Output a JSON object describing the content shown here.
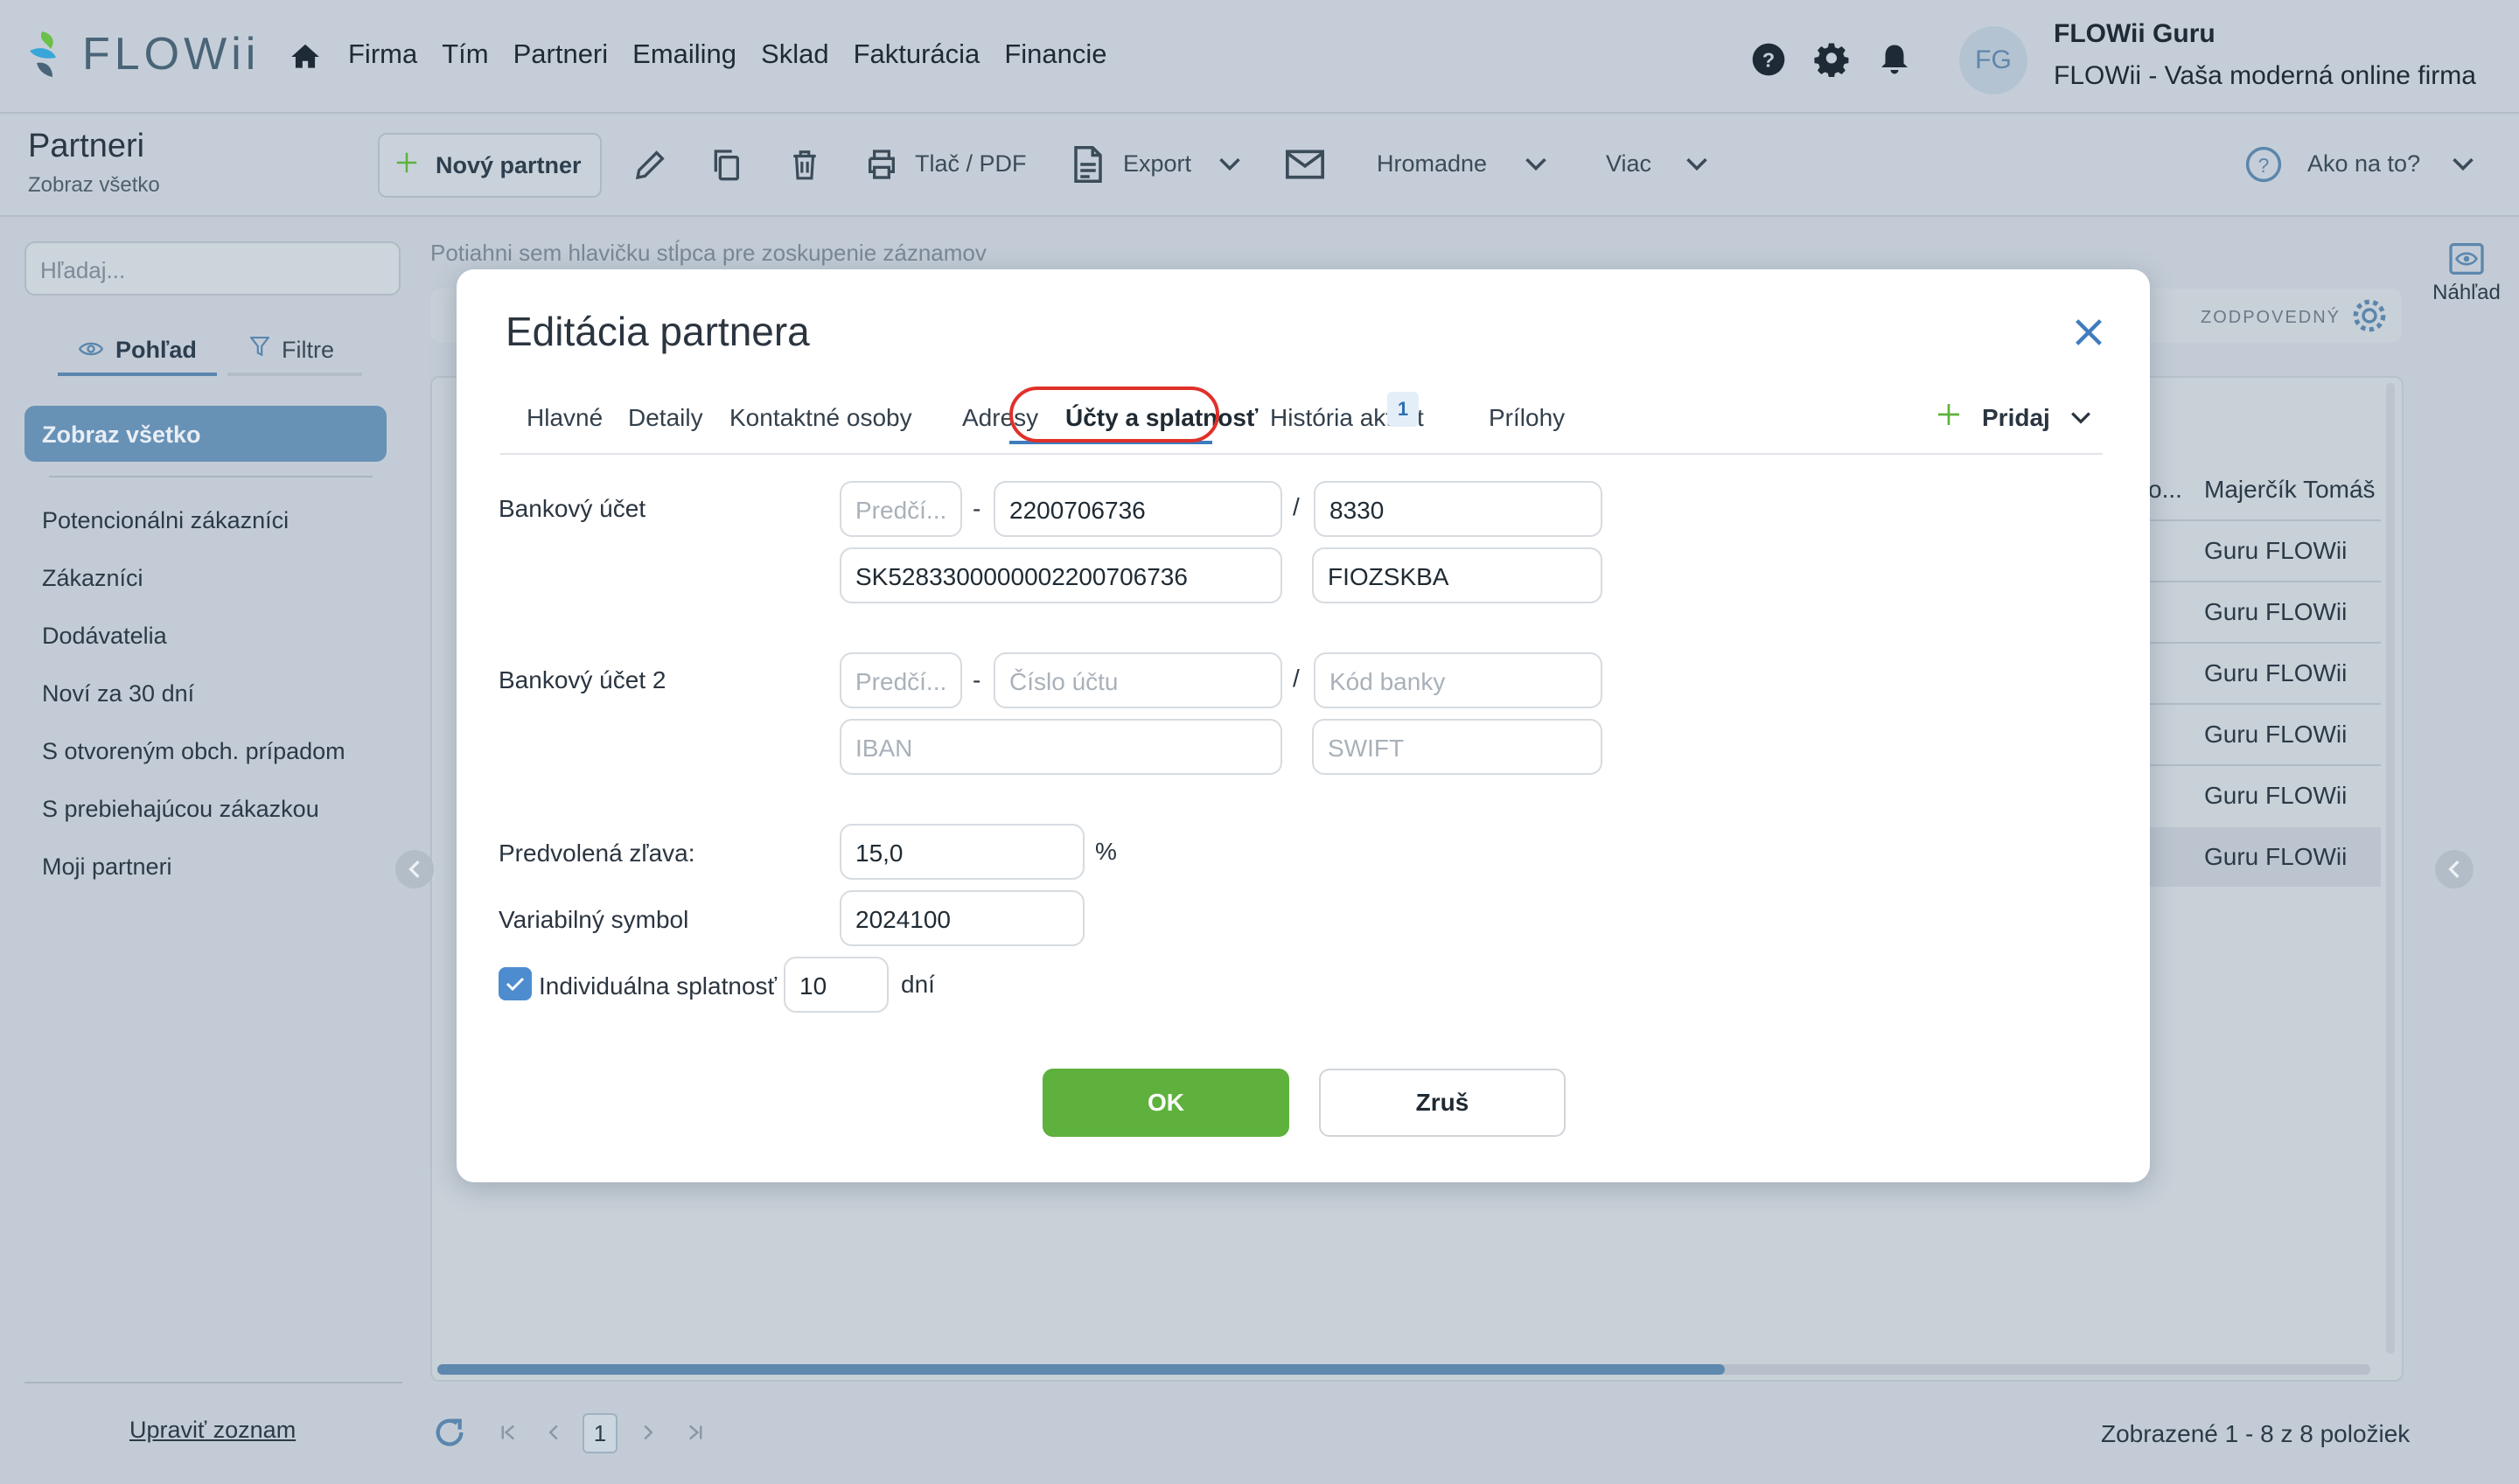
{
  "app": {
    "logo_text": "FLOWii"
  },
  "nav": {
    "menu": [
      "Firma",
      "Tím",
      "Partneri",
      "Emailing",
      "Sklad",
      "Fakturácia",
      "Financie"
    ],
    "user": {
      "initials": "FG",
      "name": "FLOWii Guru",
      "company": "FLOWii - Vaša moderná online firma"
    }
  },
  "toolbar": {
    "title": "Partneri",
    "subtitle": "Zobraz všetko",
    "new_partner": "Nový partner",
    "print": "Tlač / PDF",
    "export": "Export",
    "bulk": "Hromadne",
    "more": "Viac",
    "help": "Ako na to?"
  },
  "sidebar": {
    "search_placeholder": "Hľadaj...",
    "tab_view": "Pohľad",
    "tab_filters": "Filtre",
    "active_item": "Zobraz všetko",
    "items": [
      "Potencionálni zákazníci",
      "Zákazníci",
      "Dodávatelia",
      "Noví za 30 dní",
      "S otvoreným obch. prípadom",
      "S prebiehajúcou zákazkou",
      "Moji partneri"
    ],
    "edit_list": "Upraviť zoznam"
  },
  "grid": {
    "group_hint": "Potiahni sem hlavičku stĺpca pre zoskupenie záznamov",
    "responsible_label": "ZODPOVEDNÝ",
    "header_truncated": "o...",
    "header_name": "Majerčík Tomáš",
    "rows": [
      "Guru FLOWii",
      "Guru FLOWii",
      "Guru FLOWii",
      "Guru FLOWii",
      "Guru FLOWii",
      "Guru FLOWii"
    ],
    "preview_label": "Náhľad",
    "page": "1",
    "pager_info": "Zobrazené 1 - 8 z 8 položiek"
  },
  "modal": {
    "title": "Editácia partnera",
    "tabs": [
      "Hlavné",
      "Detaily",
      "Kontaktné osoby",
      "Adresy",
      "Účty a splatnosť",
      "História aktivít",
      "Prílohy"
    ],
    "active_tab": "Účty a splatnosť",
    "history_badge": "1",
    "add_label": "Pridaj",
    "bank1": {
      "label": "Bankový účet",
      "prefix_placeholder": "Predčí...",
      "account": "2200706736",
      "bank_code": "8330",
      "iban": "SK5283300000002200706736",
      "swift": "FIOZSKBA"
    },
    "bank2": {
      "label": "Bankový účet 2",
      "prefix_placeholder": "Predčí...",
      "account_placeholder": "Číslo účtu",
      "bank_code_placeholder": "Kód banky",
      "iban_placeholder": "IBAN",
      "swift_placeholder": "SWIFT"
    },
    "discount": {
      "label": "Predvolená zľava:",
      "value": "15,0",
      "unit": "%"
    },
    "variable_symbol": {
      "label": "Variabilný symbol",
      "value": "2024100"
    },
    "due": {
      "label": "Individuálna splatnosť",
      "checked": true,
      "value": "10",
      "unit": "dní"
    },
    "ok": "OK",
    "cancel": "Zruš"
  },
  "colors": {
    "accent": "#3f7cbf",
    "ok_green": "#5db13c",
    "highlight_red": "#e0302a"
  }
}
